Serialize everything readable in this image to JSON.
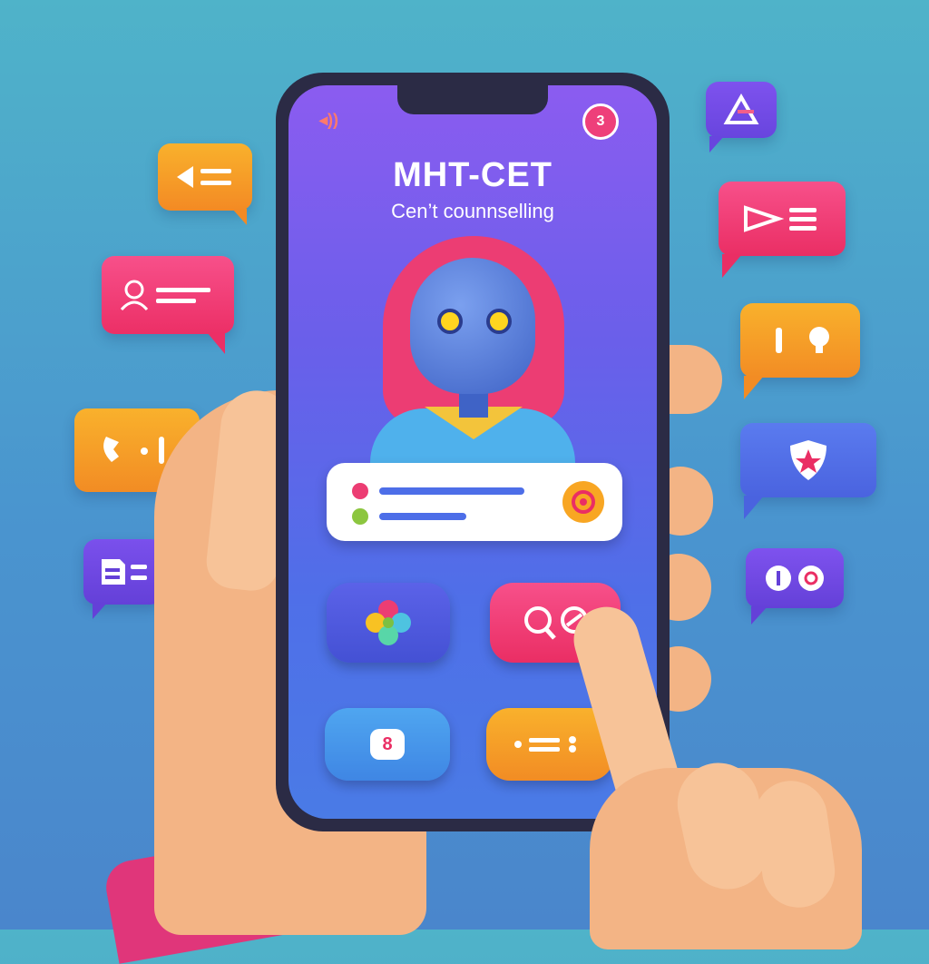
{
  "screen": {
    "title": "MHT-CET",
    "subtitle": "Cen’t counnselling",
    "notification_count": "3"
  },
  "buttons": {
    "badge_eight": "8"
  },
  "colors": {
    "background": "#4a95cf",
    "screen_top": "#8b5cf0",
    "screen_bottom": "#4a7be6",
    "accent_pink": "#ee3f7a",
    "accent_orange": "#f8a623",
    "accent_purple": "#6a4ee8"
  },
  "icons": [
    "wifi-signal-icon",
    "notification-badge",
    "robot-avatar",
    "chat-bubble-icon",
    "grid-apps-icon",
    "search-icon",
    "list-icon",
    "phone-call-icon",
    "document-icon",
    "shield-star-icon",
    "alert-icon"
  ]
}
